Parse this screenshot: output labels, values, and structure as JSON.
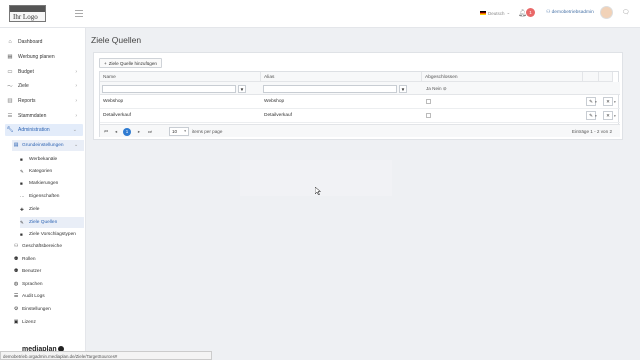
{
  "header": {
    "logo_text": "Ihr Logo",
    "language": "Deutsch",
    "notification_count": "1",
    "user": "demobetriebsadmin"
  },
  "sidebar": {
    "items": [
      {
        "label": "Dashboard",
        "icon": "home-icon"
      },
      {
        "label": "Werbung planen",
        "icon": "calendar-icon"
      },
      {
        "label": "Budget",
        "icon": "money-icon"
      },
      {
        "label": "Ziele",
        "icon": "target-icon"
      },
      {
        "label": "Reports",
        "icon": "chart-icon"
      },
      {
        "label": "Stammdaten",
        "icon": "database-icon"
      },
      {
        "label": "Administration",
        "icon": "wrench-icon"
      }
    ],
    "grundeinstellungen": "Grundeinstellungen",
    "grund_sub": [
      {
        "label": "Werbekanäle",
        "icon": "square-icon"
      },
      {
        "label": "Kategorien",
        "icon": "pencil-icon"
      },
      {
        "label": "Markierungen",
        "icon": "square-icon"
      },
      {
        "label": "Eigenschaften",
        "icon": "dots-icon"
      },
      {
        "label": "Ziele",
        "icon": "plus-icon"
      },
      {
        "label": "Ziele Quellen",
        "icon": "edit-icon"
      },
      {
        "label": "Ziele Vorschlagstypen",
        "icon": "square-icon"
      }
    ],
    "admin_sub": [
      {
        "label": "Geschäftsbereiche",
        "icon": "org-icon"
      },
      {
        "label": "Rollen",
        "icon": "users-icon"
      },
      {
        "label": "Benutzer",
        "icon": "user-icon"
      },
      {
        "label": "Sprachen",
        "icon": "globe-icon"
      },
      {
        "label": "Audit Logs",
        "icon": "list-icon"
      },
      {
        "label": "Einstellungen",
        "icon": "gear-icon"
      },
      {
        "label": "Lizenz",
        "icon": "key-icon"
      }
    ],
    "brand": "mediaplan",
    "status_url": "demobetrieb.orgadmin.mediaplan.de/Ziele/TargetSources#"
  },
  "main": {
    "title": "Ziele Quellen",
    "add_button": "Ziele Quelle hinzufügen",
    "columns": [
      "Name",
      "Alias",
      "Abgeschlossen"
    ],
    "filter_radio": "Ja  Nein",
    "rows": [
      {
        "name": "Webshop",
        "alias": "Webshop"
      },
      {
        "name": "Detailverkauf",
        "alias": "Detailverkauf"
      }
    ],
    "pager": {
      "current_page": "1",
      "page_size": "10",
      "items_label": "items per page",
      "entries": "Einträge 1 - 2 von 2"
    }
  }
}
